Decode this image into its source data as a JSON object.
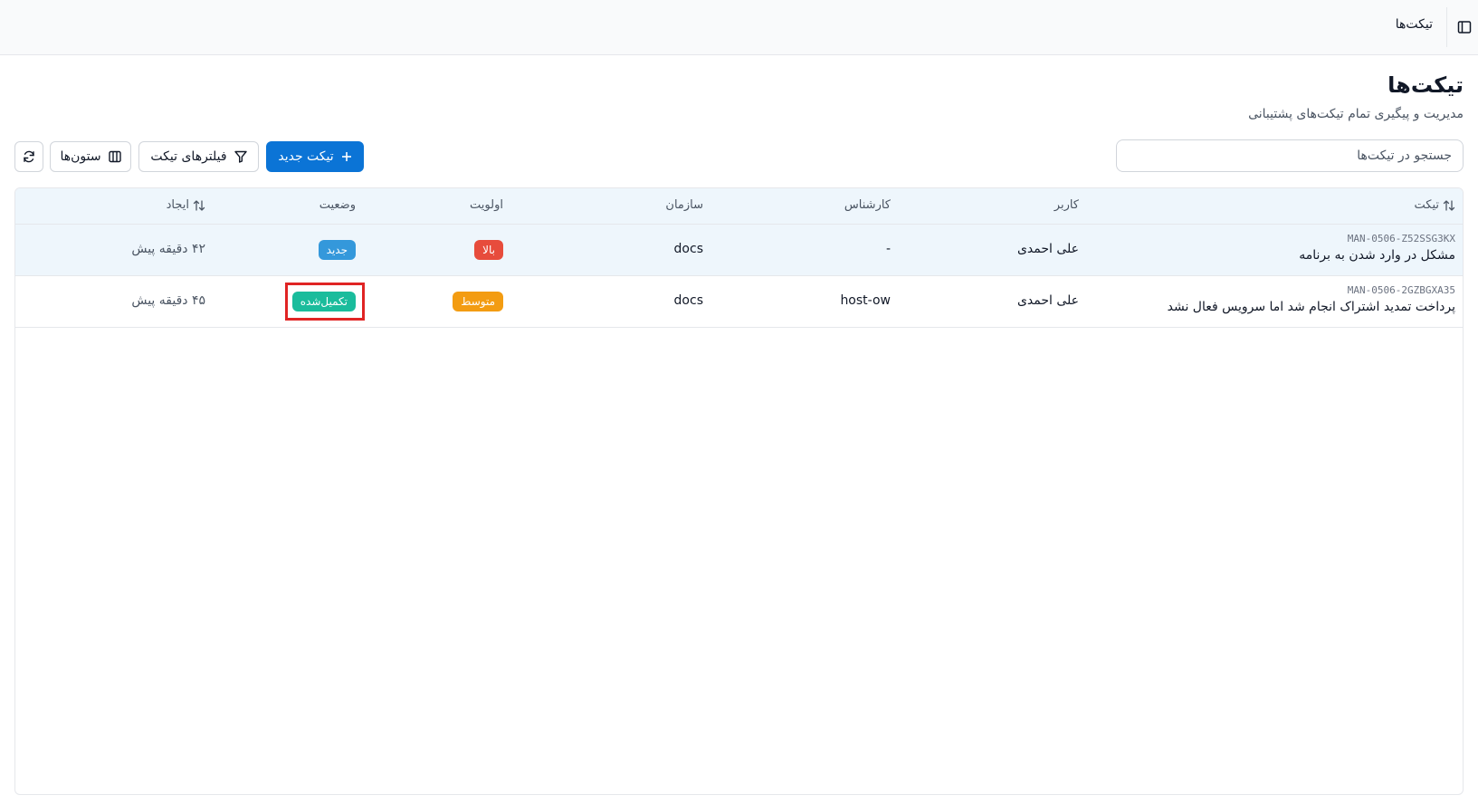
{
  "topbar": {
    "breadcrumb": "تیکت‌ها",
    "sidebar_toggle_icon": "sidebar-toggle-icon"
  },
  "page": {
    "title": "تیکت‌ها",
    "subtitle": "مدیریت و پیگیری تمام تیکت‌های پشتیبانی"
  },
  "search": {
    "placeholder": "جستجو در تیکت‌ها",
    "value": ""
  },
  "toolbar": {
    "new_ticket_label": "تیکت جدید",
    "filters_label": "فیلترهای تیکت",
    "columns_label": "ستون‌ها",
    "refresh_icon": "refresh-icon"
  },
  "table": {
    "headers": {
      "ticket": "تیکت",
      "user": "کاربر",
      "expert": "کارشناس",
      "organization": "سازمان",
      "priority": "اولویت",
      "status": "وضعیت",
      "created": "ایجاد"
    },
    "rows": [
      {
        "id": "MAN-0506-Z52SSG3KX",
        "title": "مشکل در وارد شدن به برنامه",
        "user": "علی احمدی",
        "expert": "-",
        "organization": "docs",
        "priority": "بالا",
        "status": "جدید",
        "created": "۴۲ دقیقه پیش"
      },
      {
        "id": "MAN-0506-2GZBGXA35",
        "title": "پرداخت تمدید اشتراک انجام شد اما سرویس فعال نشد",
        "user": "علی احمدی",
        "expert": "host-ow",
        "organization": "docs",
        "priority": "متوسط",
        "status": "تکمیل‌شده",
        "created": "۴۵ دقیقه پیش"
      }
    ]
  },
  "colors": {
    "primary": "#0b74d6",
    "status_new": "#3498db",
    "status_done": "#1abc9c",
    "priority_high": "#e74c3c",
    "priority_medium": "#f39c12",
    "highlight": "#e02424",
    "header_bg": "#eef6fc"
  }
}
